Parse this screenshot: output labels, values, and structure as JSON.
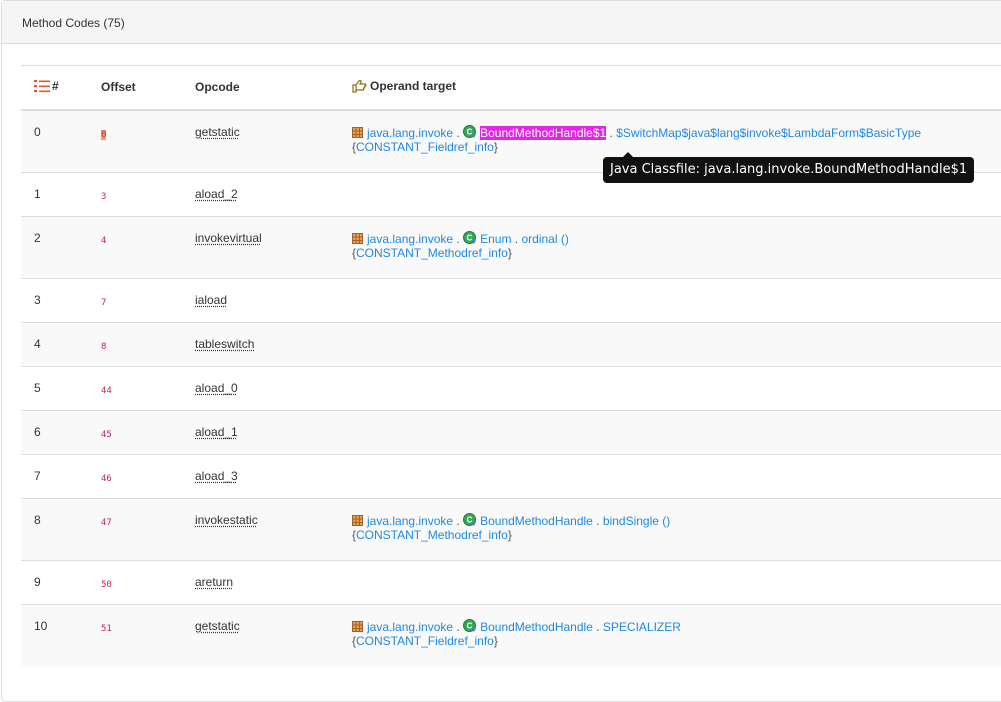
{
  "panel": {
    "title": "Method Codes (75)"
  },
  "table": {
    "headers": {
      "index": "#",
      "offset": "Offset",
      "opcode": "Opcode",
      "operand": "Operand target"
    },
    "rows": [
      {
        "index": "0",
        "offset": "0",
        "opcode": "getstatic",
        "pkg": "java.lang.invoke",
        "cls": "BoundMethodHandle$1",
        "member": "$SwitchMap$java$lang$invoke$LambdaForm$BasicType",
        "ref": "CONSTANT_Fieldref_info"
      },
      {
        "index": "1",
        "offset": "3",
        "opcode": "aload_2"
      },
      {
        "index": "2",
        "offset": "4",
        "opcode": "invokevirtual",
        "pkg": "java.lang.invoke",
        "cls": "Enum",
        "member": "ordinal ()",
        "ref": "CONSTANT_Methodref_info"
      },
      {
        "index": "3",
        "offset": "7",
        "opcode": "iaload"
      },
      {
        "index": "4",
        "offset": "8",
        "opcode": "tableswitch"
      },
      {
        "index": "5",
        "offset": "44",
        "opcode": "aload_0"
      },
      {
        "index": "6",
        "offset": "45",
        "opcode": "aload_1"
      },
      {
        "index": "7",
        "offset": "46",
        "opcode": "aload_3"
      },
      {
        "index": "8",
        "offset": "47",
        "opcode": "invokestatic",
        "pkg": "java.lang.invoke",
        "cls": "BoundMethodHandle",
        "member": "bindSingle ()",
        "ref": "CONSTANT_Methodref_info"
      },
      {
        "index": "9",
        "offset": "50",
        "opcode": "areturn"
      },
      {
        "index": "10",
        "offset": "51",
        "opcode": "getstatic",
        "pkg": "java.lang.invoke",
        "cls": "BoundMethodHandle",
        "member": "SPECIALIZER",
        "ref": "CONSTANT_Fieldref_info"
      }
    ]
  },
  "tooltip": {
    "text": "Java Classfile: java.lang.invoke.BoundMethodHandle$1"
  },
  "icons": {
    "list": "list-ordered-icon",
    "operand": "pointing-hand-icon",
    "package": "package-icon",
    "class": "class-icon"
  },
  "colors": {
    "link": "#1e88e5",
    "offset": "#c7254e",
    "highlight": "#e028e0",
    "offset_highlight": "#f0a070",
    "icon_orange": "#e8572a"
  }
}
